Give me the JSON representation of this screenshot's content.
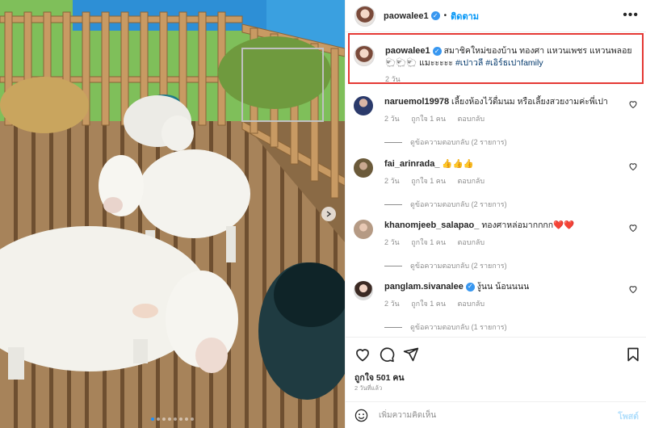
{
  "post": {
    "author": "paowalee1",
    "follow_label": "ติดตาม",
    "separator": "•",
    "more_icon": "more-horizontal-icon"
  },
  "caption": {
    "username": "paowalee1",
    "text": "สมาชิคใหม่ของบ้าน ทองศา แหวนเพชร แหวนพลอย",
    "emoji": "🐑🐑🐑",
    "text2": "แมะะะะะ",
    "tags": [
      "#เปาวลี",
      "#เอิร์ธเปาfamily"
    ],
    "time": "2 วัน"
  },
  "comments": [
    {
      "username": "naruemol19978",
      "text": "เลี้ยงห้องไว้ดื่มนม หรือเลี้ยงสวยงามค่ะพี่เปา",
      "time": "2 วัน",
      "likes": "ถูกใจ 1 คน",
      "reply": "ตอบกลับ",
      "view_replies": "ดูข้อความตอบกลับ (2 รายการ)",
      "verified": false
    },
    {
      "username": "fai_arinrada_",
      "text": "👍👍👍",
      "time": "2 วัน",
      "likes": "ถูกใจ 1 คน",
      "reply": "ตอบกลับ",
      "view_replies": "ดูข้อความตอบกลับ (2 รายการ)",
      "verified": false
    },
    {
      "username": "khanomjeeb_salapao_",
      "text": "ทองศาหล่อมากกกก❤️❤️",
      "time": "2 วัน",
      "likes": "ถูกใจ 1 คน",
      "reply": "ตอบกลับ",
      "view_replies": "ดูข้อความตอบกลับ (2 รายการ)",
      "verified": false
    },
    {
      "username": "panglam.sivanalee",
      "text": "งู้นน น้อนนนน",
      "time": "2 วัน",
      "likes": "ถูกใจ 1 คน",
      "reply": "ตอบกลับ",
      "view_replies": "ดูข้อความตอบกลับ (1 รายการ)",
      "verified": true
    }
  ],
  "footer": {
    "likes": "ถูกใจ 501 คน",
    "date": "2 วันที่แล้ว",
    "comment_placeholder": "เพิ่มความคิดเห็น",
    "post_label": "โพสต์"
  },
  "carousel": {
    "slide_count": 8,
    "active_slide": 1
  },
  "colors": {
    "accent": "#0095f6",
    "verified": "#3897f0",
    "highlight_border": "#e53935",
    "heart": "#e0245e"
  }
}
